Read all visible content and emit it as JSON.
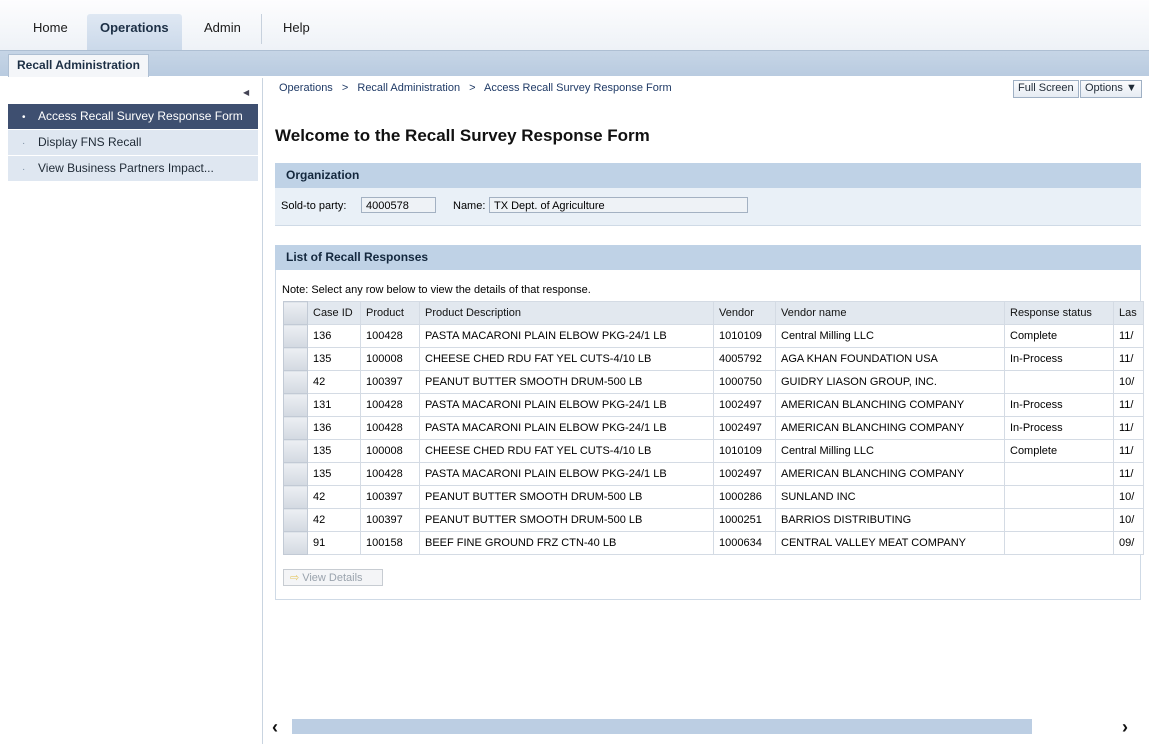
{
  "topnav": {
    "tabs": [
      {
        "label": "Home"
      },
      {
        "label": "Operations"
      },
      {
        "label": "Admin"
      },
      {
        "label": "Help"
      }
    ],
    "active_tab": "Operations"
  },
  "subnav": {
    "active_label": "Recall Administration"
  },
  "sidebar": {
    "items": [
      {
        "label": "Access Recall Survey Response Form"
      },
      {
        "label": "Display FNS Recall"
      },
      {
        "label": "View Business Partners Impact..."
      }
    ]
  },
  "breadcrumb": {
    "items": [
      "Operations",
      ">",
      "Recall Administration",
      ">",
      "Access Recall Survey Response Form"
    ]
  },
  "toolbar": {
    "full_screen_label": "Full Screen",
    "options_label": "Options ▼"
  },
  "page": {
    "title": "Welcome to the Recall Survey Response Form"
  },
  "organization": {
    "header": "Organization",
    "sold_to_label": "Sold-to party:",
    "sold_to_value": "4000578",
    "name_label": "Name:",
    "name_value": "TX Dept. of Agriculture"
  },
  "responses": {
    "header": "List of Recall Responses",
    "note": "Note: Select any row below to view the details of that response.",
    "columns": [
      "Case ID",
      "Product",
      "Product Description",
      "Vendor",
      "Vendor name",
      "Response status",
      "Las"
    ],
    "rows": [
      [
        "136",
        "100428",
        "PASTA MACARONI PLAIN ELBOW PKG-24/1 LB",
        "1010109",
        "Central Milling LLC",
        "Complete",
        "11/"
      ],
      [
        "135",
        "100008",
        "CHEESE CHED RDU FAT YEL CUTS-4/10 LB",
        "4005792",
        "AGA KHAN FOUNDATION USA",
        "In-Process",
        "11/"
      ],
      [
        "42",
        "100397",
        "PEANUT BUTTER SMOOTH DRUM-500 LB",
        "1000750",
        "GUIDRY LIASON GROUP, INC.",
        "",
        "10/"
      ],
      [
        "131",
        "100428",
        "PASTA MACARONI PLAIN ELBOW PKG-24/1 LB",
        "1002497",
        "AMERICAN BLANCHING COMPANY",
        "In-Process",
        "11/"
      ],
      [
        "136",
        "100428",
        "PASTA MACARONI PLAIN ELBOW PKG-24/1 LB",
        "1002497",
        "AMERICAN BLANCHING COMPANY",
        "In-Process",
        "11/"
      ],
      [
        "135",
        "100008",
        "CHEESE CHED RDU FAT YEL CUTS-4/10 LB",
        "1010109",
        "Central Milling LLC",
        "Complete",
        "11/"
      ],
      [
        "135",
        "100428",
        "PASTA MACARONI PLAIN ELBOW PKG-24/1 LB",
        "1002497",
        "AMERICAN BLANCHING COMPANY",
        "",
        "11/"
      ],
      [
        "42",
        "100397",
        "PEANUT BUTTER SMOOTH DRUM-500 LB",
        "1000286",
        "SUNLAND INC",
        "",
        "10/"
      ],
      [
        "42",
        "100397",
        "PEANUT BUTTER SMOOTH DRUM-500 LB",
        "1000251",
        "BARRIOS DISTRIBUTING",
        "",
        "10/"
      ],
      [
        "91",
        "100158",
        "BEEF FINE GROUND FRZ CTN-40 LB",
        "1000634",
        "CENTRAL VALLEY MEAT COMPANY",
        "",
        "09/"
      ]
    ],
    "view_details_label": "View Details"
  },
  "colors": {
    "accent_header": "#bfd2e6",
    "selected_nav": "#3e4f70"
  }
}
